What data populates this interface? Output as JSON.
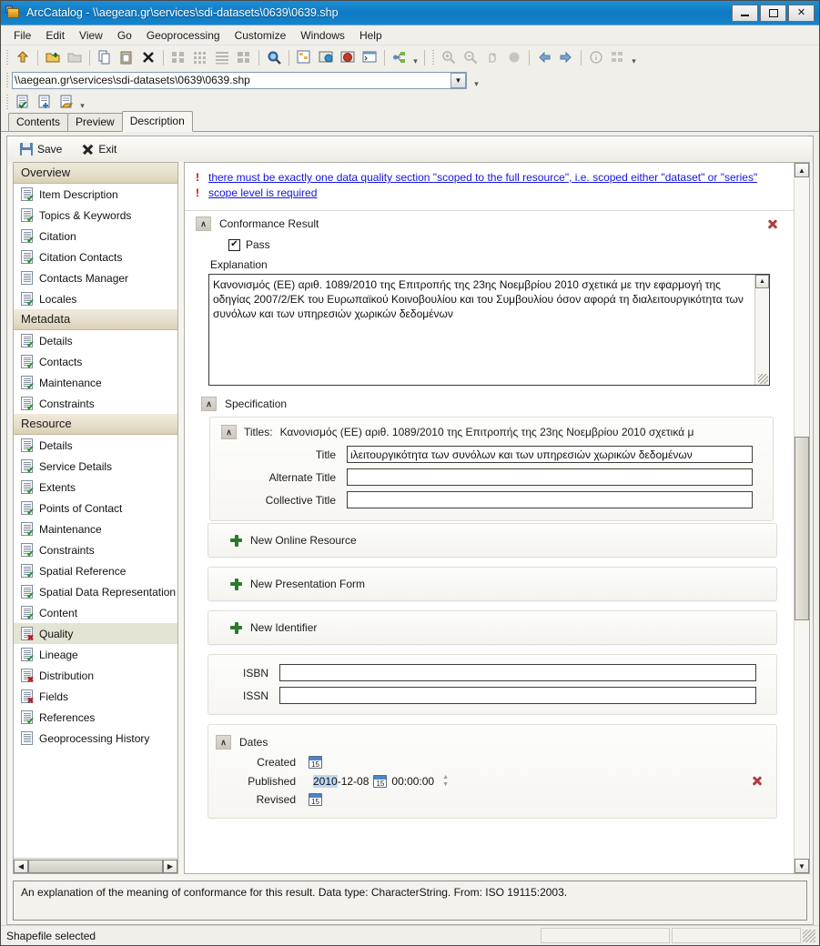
{
  "window": {
    "title": "ArcCatalog - \\\\aegean.gr\\services\\sdi-datasets\\0639\\0639.shp",
    "minimize_label": "Minimize",
    "maximize_label": "Maximize",
    "close_label": "✕"
  },
  "menu": [
    "File",
    "Edit",
    "View",
    "Go",
    "Geoprocessing",
    "Customize",
    "Windows",
    "Help"
  ],
  "path_bar": {
    "value": "\\\\aegean.gr\\services\\sdi-datasets\\0639\\0639.shp"
  },
  "tabs": [
    {
      "label": "Contents",
      "active": false
    },
    {
      "label": "Preview",
      "active": false
    },
    {
      "label": "Description",
      "active": true
    }
  ],
  "editor_toolbar": {
    "save_label": "Save",
    "exit_label": "Exit"
  },
  "sidebar": {
    "groups": [
      {
        "header": "Overview",
        "items": [
          {
            "label": "Item Description",
            "status": "ok"
          },
          {
            "label": "Topics & Keywords",
            "status": "ok"
          },
          {
            "label": "Citation",
            "status": "ok"
          },
          {
            "label": "Citation Contacts",
            "status": "ok"
          },
          {
            "label": "Contacts Manager",
            "status": "none"
          },
          {
            "label": "Locales",
            "status": "ok"
          }
        ]
      },
      {
        "header": "Metadata",
        "items": [
          {
            "label": "Details",
            "status": "ok"
          },
          {
            "label": "Contacts",
            "status": "ok"
          },
          {
            "label": "Maintenance",
            "status": "ok"
          },
          {
            "label": "Constraints",
            "status": "ok"
          }
        ]
      },
      {
        "header": "Resource",
        "items": [
          {
            "label": "Details",
            "status": "ok"
          },
          {
            "label": "Service Details",
            "status": "ok"
          },
          {
            "label": "Extents",
            "status": "ok"
          },
          {
            "label": "Points of Contact",
            "status": "ok"
          },
          {
            "label": "Maintenance",
            "status": "ok"
          },
          {
            "label": "Constraints",
            "status": "ok"
          },
          {
            "label": "Spatial Reference",
            "status": "ok"
          },
          {
            "label": "Spatial Data Representation",
            "status": "ok"
          },
          {
            "label": "Content",
            "status": "ok"
          },
          {
            "label": "Quality",
            "status": "err",
            "selected": true
          },
          {
            "label": "Lineage",
            "status": "ok"
          },
          {
            "label": "Distribution",
            "status": "err"
          },
          {
            "label": "Fields",
            "status": "err"
          },
          {
            "label": "References",
            "status": "ok"
          },
          {
            "label": "Geoprocessing History",
            "status": "none"
          }
        ]
      }
    ]
  },
  "errors": [
    "there must be exactly one data quality section \"scoped to the full resource\", i.e. scoped either \"dataset\" or \"series\"",
    "scope level is required"
  ],
  "conformance_result": {
    "section_title": "Conformance Result",
    "pass_label": "Pass",
    "pass_checked": true,
    "check_glyph": "✔",
    "explanation_label": "Explanation",
    "explanation_text": "Κανονισμός (ΕΕ) αριθ. 1089/2010 της Επιτροπής της 23ης Νοεμβρίου 2010 σχετικά με την εφαρμογή της οδηγίας 2007/2/ΕΚ του Ευρωπαϊκού Κοινοβουλίου και του Συμβουλίου όσον αφορά τη διαλειτουργικότητα των συνόλων και των υπηρεσιών χωρικών δεδομένων"
  },
  "specification": {
    "section_title": "Specification",
    "titles_group": {
      "label": "Titles:",
      "summary": "Κανονισμός (ΕΕ) αριθ. 1089/2010 της Επιτροπής της 23ης Νοεμβρίου 2010 σχετικά μ",
      "fields": [
        {
          "label": "Title",
          "value": "ιλειτουργικότητα των συνόλων και των υπηρεσιών χωρικών δεδομένων"
        },
        {
          "label": "Alternate Title",
          "value": ""
        },
        {
          "label": "Collective Title",
          "value": ""
        }
      ]
    },
    "add_buttons": [
      {
        "label": "New Online Resource"
      },
      {
        "label": "New Presentation Form"
      },
      {
        "label": "New Identifier"
      }
    ],
    "identifiers": [
      {
        "label": "ISBN",
        "value": ""
      },
      {
        "label": "ISSN",
        "value": ""
      }
    ],
    "dates": {
      "section_title": "Dates",
      "rows": [
        {
          "label": "Created",
          "date": "",
          "selected_part": "",
          "time": "",
          "has_spinner": false,
          "has_delete": false
        },
        {
          "label": "Published",
          "date_selected": "2010",
          "date_rest": "-12-08",
          "time": "00:00:00",
          "has_spinner": true,
          "has_delete": true
        },
        {
          "label": "Revised",
          "date": "",
          "selected_part": "",
          "time": "",
          "has_spinner": false,
          "has_delete": false
        }
      ]
    }
  },
  "hint": "An explanation of the meaning of conformance for this result. Data type: CharacterString. From: ISO 19115:2003.",
  "statusbar": {
    "message": "Shapefile selected"
  },
  "colors": {
    "titlebar_blue": "#1285cd",
    "link_blue": "#1414e0",
    "error_red": "#d00000",
    "delete_red": "#b13d3d",
    "selection_blue": "#bcd9f0",
    "ok_green": "#2c8f2c",
    "add_green": "#2a7a2a"
  }
}
